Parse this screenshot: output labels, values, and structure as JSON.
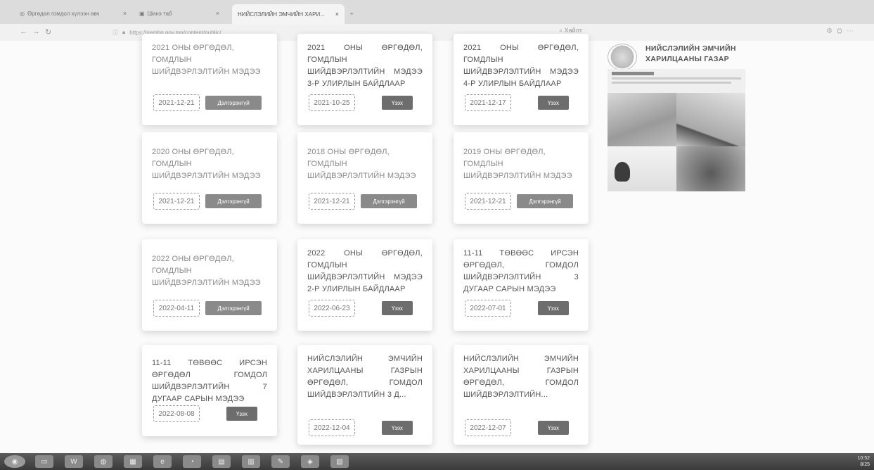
{
  "browser": {
    "tabs": [
      {
        "label": "Өргөдөл гомдол хүлээн авч"
      },
      {
        "label": "Шинэ таб"
      },
      {
        "label": "НИЙСЛЭЛИЙН ЭМЧИЙН ХАРИ..."
      }
    ],
    "url": "https://nemhg.gov.mn/content/public/",
    "search_label": "Хайлт"
  },
  "cards": [
    {
      "title": "2021 ОНЫ ӨРГӨДӨЛ, ГОМДЛЫН ШИЙДВЭРЛЭЛТИЙН МЭДЭЭ",
      "date": "2021-12-21",
      "button": "Дэлгэрэнгүй"
    },
    {
      "title": "2021 ОНЫ ӨРГӨДӨЛ, ГОМДЛЫН ШИЙДВЭРЛЭЛТИЙН МЭДЭЭ 3-Р УЛИРЛЫН БАЙДЛААР",
      "date": "2021-10-25",
      "button": "Үзэх"
    },
    {
      "title": "2021 ОНЫ ӨРГӨДӨЛ, ГОМДЛЫН ШИЙДВЭРЛЭЛТИЙН МЭДЭЭ 4-Р УЛИРЛЫН БАЙДЛААР",
      "date": "2021-12-17",
      "button": "Үзэх"
    },
    {
      "title": "2020 ОНЫ ӨРГӨДӨЛ, ГОМДЛЫН ШИЙДВЭРЛЭЛТИЙН МЭДЭЭ",
      "date": "2021-12-21",
      "button": "Дэлгэрэнгүй"
    },
    {
      "title": "2018 ОНЫ ӨРГӨДӨЛ, ГОМДЛЫН ШИЙДВЭРЛЭЛТИЙН МЭДЭЭ",
      "date": "2021-12-21",
      "button": "Дэлгэрэнгүй"
    },
    {
      "title": "2019 ОНЫ ӨРГӨДӨЛ, ГОМДЛЫН ШИЙДВЭРЛЭЛТИЙН МЭДЭЭ",
      "date": "2021-12-21",
      "button": "Дэлгэрэнгүй"
    },
    {
      "title": "2022 ОНЫ ӨРГӨДӨЛ, ГОМДЛЫН ШИЙДВЭРЛЭЛТИЙН МЭДЭЭ",
      "date": "2022-04-11",
      "button": "Дэлгэрэнгүй"
    },
    {
      "title": "2022 ОНЫ ӨРГӨДӨЛ, ГОМДЛЫН ШИЙДВЭРЛЭЛТИЙН МЭДЭЭ 2-Р УЛИРЛЫН БАЙДЛААР",
      "date": "2022-06-23",
      "button": "Үзэх"
    },
    {
      "title": "11-11 ТӨВӨӨС ИРСЭН ӨРГӨДӨЛ, ГОМДОЛ ШИЙДВЭРЛЭЛТИЙН 3 ДУГААР САРЫН МЭДЭЭ",
      "date": "2022-07-01",
      "button": "Үзэх"
    },
    {
      "title": "11-11 ТӨВӨӨС ИРСЭН ӨРГӨДӨЛ ГОМДОЛ ШИЙДВЭРЛЭЛТИЙН 7 ДУГААР САРЫН МЭДЭЭ",
      "date": "2022-08-08",
      "button": "Үзэх"
    },
    {
      "title": "НИЙСЛЭЛИЙН ЭМЧИЙН ХАРИЛЦААНЫ ГАЗРЫН ӨРГӨДӨЛ, ГОМДОЛ ШИЙДВЭРЛЭЛТИЙН 3 Д...",
      "date": "2022-12-04",
      "button": "Үзэх"
    },
    {
      "title": "НИЙСЛЭЛИЙН ЭМЧИЙН ХАРИЛЦААНЫ ГАЗРЫН ӨРГӨДӨЛ, ГОМДОЛ ШИЙДВЭРЛЭЛТИЙН...",
      "date": "2022-12-07",
      "button": "Үзэх"
    }
  ],
  "sidebar": {
    "org_line1": "НИЙСЛЭЛИЙН ЭМЧИЙН",
    "org_line2": "ХАРИЛЦААНЫ ГАЗАР"
  },
  "taskbar": {
    "time": "10:52",
    "date": "8/25"
  }
}
